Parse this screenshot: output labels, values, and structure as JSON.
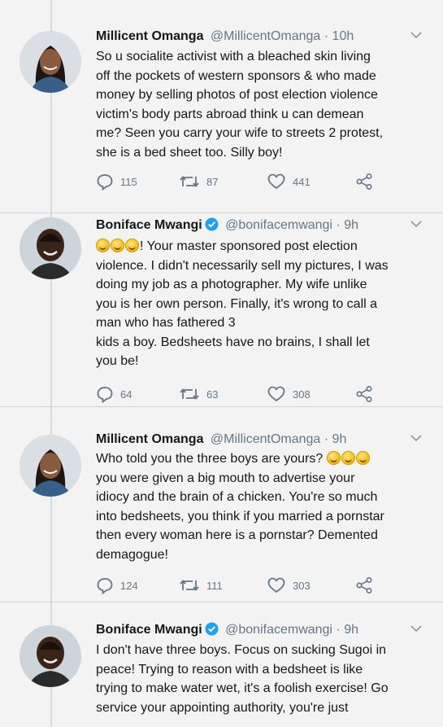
{
  "tweets": [
    {
      "name": "Millicent Omanga",
      "handle": "@MillicentOmanga",
      "time": "· 10h",
      "verified": false,
      "avatar": "woman-avatar",
      "lines": [
        "So u socialite activist with a bleached skin living",
        "off the pockets of western sponsors & who made",
        "money by selling photos of post election violence",
        "victim's body parts abroad think u can demean",
        "me? Seen you carry your wife to streets 2 protest,",
        "she is a bed sheet too. Silly boy!"
      ],
      "replies": "115",
      "retweets": "87",
      "likes": "441"
    },
    {
      "name": "Boniface Mwangi",
      "handle": "@bonifacemwangi",
      "time": "· 9h",
      "verified": true,
      "avatar": "man-avatar",
      "lead_emojis": 3,
      "lines": [
        "! Your master sponsored post election",
        "violence. I didn't necessarily sell my pictures, I was",
        "doing my job as a photographer. My wife unlike",
        "you is her own person. Finally, it's wrong to call a",
        "man who has fathered 3",
        "kids a boy. Bedsheets have no brains, I shall let",
        "you be!"
      ],
      "replies": "64",
      "retweets": "63",
      "likes": "308"
    },
    {
      "name": "Millicent Omanga",
      "handle": "@MillicentOmanga",
      "time": "· 9h",
      "verified": false,
      "avatar": "woman-avatar",
      "lines": [
        "Who told you the three boys are yours?",
        "you were given a big mouth to advertise your",
        "idiocy and the brain of a chicken. You're so much",
        "into bedsheets, you think if you married a pornstar",
        "then every woman here is a pornstar? Demented",
        "demagogue!"
      ],
      "trail_emojis": 3,
      "replies": "124",
      "retweets": "111",
      "likes": "303"
    },
    {
      "name": "Boniface Mwangi",
      "handle": "@bonifacemwangi",
      "time": "· 9h",
      "verified": true,
      "avatar": "man-avatar",
      "lines": [
        "I don't have three boys. Focus on sucking Sugoi in",
        "peace! Trying to reason with a bedsheet is like",
        "trying to make water wet, it's a foolish exercise! Go",
        "service your appointing authority, you're just"
      ]
    }
  ],
  "colors": {
    "background": "#f3f3f3",
    "text": "#14171a",
    "secondary": "#657786",
    "verified": "#1da1f2"
  }
}
